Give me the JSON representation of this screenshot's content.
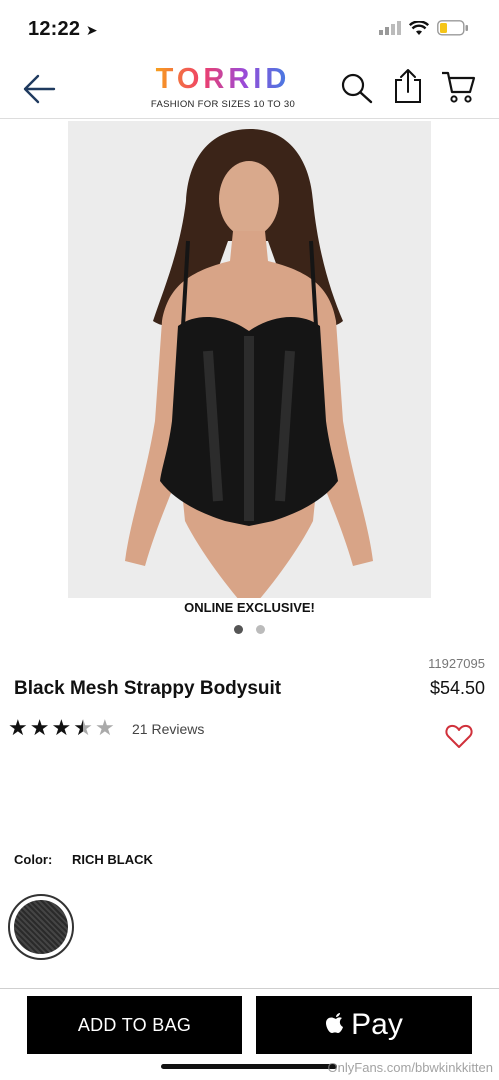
{
  "status": {
    "time": "12:22"
  },
  "header": {
    "logo": "TORRID",
    "tagline": "FASHION FOR SIZES 10 TO 30"
  },
  "product": {
    "badge": "ONLINE EXCLUSIVE!",
    "sku": "11927095",
    "title": "Black Mesh Strappy Bodysuit",
    "price": "$54.50",
    "rating": 3.5,
    "reviews": "21 Reviews",
    "color_label": "Color:",
    "color_value": "RICH BLACK",
    "image_count": 2,
    "active_image": 1
  },
  "actions": {
    "add_to_bag": "ADD TO BAG",
    "apple_pay": "Pay"
  },
  "watermark": "OnlyFans.com/bbwkinkkitten",
  "icons": [
    "location-arrow-icon",
    "signal-icon",
    "wifi-icon",
    "battery-icon",
    "back-arrow-icon",
    "search-icon",
    "share-icon",
    "cart-icon",
    "heart-icon",
    "apple-icon"
  ],
  "colors": {
    "accent": "#d0313b",
    "button": "#000000"
  }
}
